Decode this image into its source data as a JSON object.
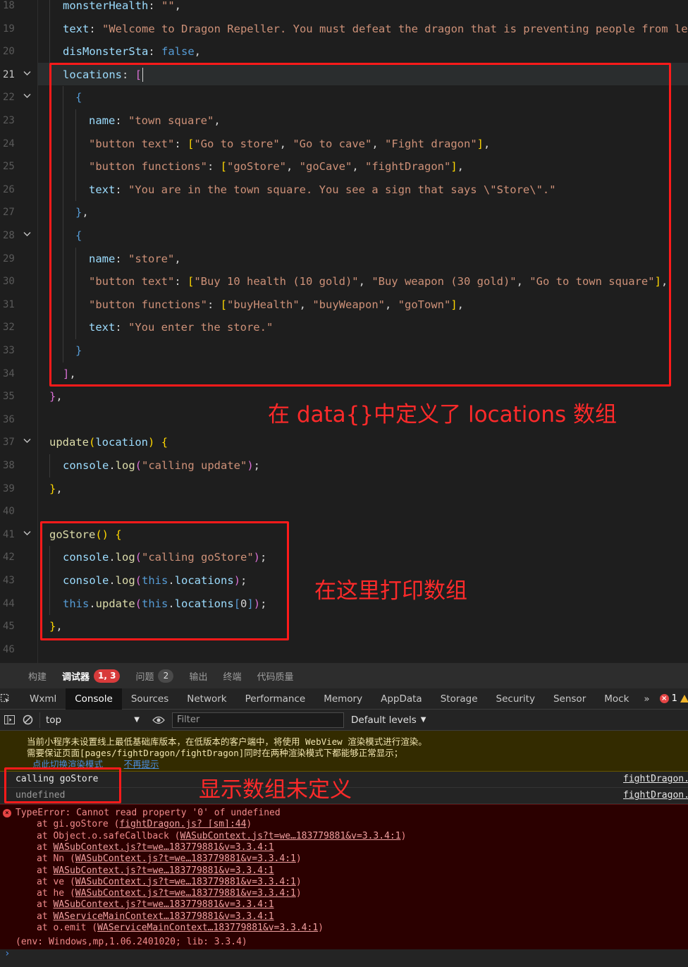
{
  "editor": {
    "lines": [
      {
        "n": "18",
        "indent": 1,
        "html": "<span class='k'>monsterHealth</span><span class='w'>: </span><span class='s'>\"\"</span><span class='w'>,</span>"
      },
      {
        "n": "19",
        "indent": 1,
        "html": "<span class='k'>text</span><span class='w'>: </span><span class='s'>\"Welcome to Dragon Repeller. You must defeat the dragon that is preventing people from leav</span>"
      },
      {
        "n": "20",
        "indent": 1,
        "html": "<span class='k'>disMonsterSta</span><span class='w'>: </span><span class='b'>false</span><span class='w'>,</span>"
      },
      {
        "n": "21",
        "indent": 1,
        "fold": true,
        "active": true,
        "html": "<span class='k'>locations</span><span class='w'>: </span><span class='p'>[</span>"
      },
      {
        "n": "22",
        "indent": 2,
        "fold": true,
        "html": "<span class='b'>{</span>"
      },
      {
        "n": "23",
        "indent": 3,
        "html": "<span class='k'>name</span><span class='w'>: </span><span class='s'>\"town square\"</span><span class='w'>,</span>"
      },
      {
        "n": "24",
        "indent": 3,
        "html": "<span class='s'>\"button text\"</span><span class='w'>: </span><span class='y'>[</span><span class='s'>\"Go to store\"</span><span class='w'>, </span><span class='s'>\"Go to cave\"</span><span class='w'>, </span><span class='s'>\"Fight dragon\"</span><span class='y'>]</span><span class='w'>,</span>"
      },
      {
        "n": "25",
        "indent": 3,
        "html": "<span class='s'>\"button functions\"</span><span class='w'>: </span><span class='y'>[</span><span class='s'>\"goStore\"</span><span class='w'>, </span><span class='s'>\"goCave\"</span><span class='w'>, </span><span class='s'>\"fightDragon\"</span><span class='y'>]</span><span class='w'>,</span>"
      },
      {
        "n": "26",
        "indent": 3,
        "html": "<span class='k'>text</span><span class='w'>: </span><span class='s'>\"You are in the town square. You see a sign that says \\\"Store\\\".\"</span>"
      },
      {
        "n": "27",
        "indent": 2,
        "html": "<span class='b'>}</span><span class='w'>,</span>"
      },
      {
        "n": "28",
        "indent": 2,
        "fold": true,
        "html": "<span class='b'>{</span>"
      },
      {
        "n": "29",
        "indent": 3,
        "html": "<span class='k'>name</span><span class='w'>: </span><span class='s'>\"store\"</span><span class='w'>,</span>"
      },
      {
        "n": "30",
        "indent": 3,
        "html": "<span class='s'>\"button text\"</span><span class='w'>: </span><span class='y'>[</span><span class='s'>\"Buy 10 health (10 gold)\"</span><span class='w'>, </span><span class='s'>\"Buy weapon (30 gold)\"</span><span class='w'>, </span><span class='s'>\"Go to town square\"</span><span class='y'>]</span><span class='w'>,</span>"
      },
      {
        "n": "31",
        "indent": 3,
        "html": "<span class='s'>\"button functions\"</span><span class='w'>: </span><span class='y'>[</span><span class='s'>\"buyHealth\"</span><span class='w'>, </span><span class='s'>\"buyWeapon\"</span><span class='w'>, </span><span class='s'>\"goTown\"</span><span class='y'>]</span><span class='w'>,</span>"
      },
      {
        "n": "32",
        "indent": 3,
        "html": "<span class='k'>text</span><span class='w'>: </span><span class='s'>\"You enter the store.\"</span>"
      },
      {
        "n": "33",
        "indent": 2,
        "html": "<span class='b'>}</span>"
      },
      {
        "n": "34",
        "indent": 1,
        "html": "<span class='p'>]</span><span class='w'>,</span>"
      },
      {
        "n": "35",
        "indent": 0,
        "html": "<span class='p'>}</span><span class='w'>,</span>"
      },
      {
        "n": "36",
        "indent": 0,
        "html": ""
      },
      {
        "n": "37",
        "indent": 0,
        "fold": true,
        "html": "<span class='f'>update</span><span class='y'>(</span><span class='k'>location</span><span class='y'>)</span><span class='w'> </span><span class='y'>{</span>"
      },
      {
        "n": "38",
        "indent": 1,
        "html": "<span class='k'>console</span><span class='w'>.</span><span class='f'>log</span><span class='p'>(</span><span class='s'>\"calling update\"</span><span class='p'>)</span><span class='w'>;</span>"
      },
      {
        "n": "39",
        "indent": 0,
        "html": "<span class='y'>}</span><span class='w'>,</span>"
      },
      {
        "n": "40",
        "indent": 0,
        "html": ""
      },
      {
        "n": "41",
        "indent": 0,
        "fold": true,
        "html": "<span class='f'>goStore</span><span class='y'>()</span><span class='w'> </span><span class='y'>{</span>"
      },
      {
        "n": "42",
        "indent": 1,
        "html": "<span class='k'>console</span><span class='w'>.</span><span class='f'>log</span><span class='p'>(</span><span class='s'>\"calling goStore\"</span><span class='p'>)</span><span class='w'>;</span>"
      },
      {
        "n": "43",
        "indent": 1,
        "html": "<span class='k'>console</span><span class='w'>.</span><span class='f'>log</span><span class='p'>(</span><span class='b'>this</span><span class='w'>.</span><span class='k'>locations</span><span class='p'>)</span><span class='w'>;</span>"
      },
      {
        "n": "44",
        "indent": 1,
        "html": "<span class='b'>this</span><span class='w'>.</span><span class='f'>update</span><span class='p'>(</span><span class='b'>this</span><span class='w'>.</span><span class='k'>locations</span><span class='b'>[</span><span class='w'>0</span><span class='b'>]</span><span class='p'>)</span><span class='w'>;</span>"
      },
      {
        "n": "45",
        "indent": 0,
        "html": "<span class='y'>}</span><span class='w'>,</span>"
      },
      {
        "n": "46",
        "indent": 0,
        "html": ""
      }
    ]
  },
  "annotations": {
    "locations_note": "在 data{}中定义了 locations 数组",
    "print_note": "在这里打印数组",
    "undefined_note": "显示数组未定义"
  },
  "panel_tabs": [
    {
      "label": "构建",
      "active": false
    },
    {
      "label": "调试器",
      "active": true,
      "badge": "1, 3",
      "badge_style": "red"
    },
    {
      "label": "问题",
      "active": false,
      "badge": "2",
      "badge_style": "gray"
    },
    {
      "label": "输出",
      "active": false
    },
    {
      "label": "终端",
      "active": false
    },
    {
      "label": "代码质量",
      "active": false
    }
  ],
  "devtools_tabs": [
    {
      "label": "Wxml",
      "active": false
    },
    {
      "label": "Console",
      "active": true
    },
    {
      "label": "Sources",
      "active": false
    },
    {
      "label": "Network",
      "active": false
    },
    {
      "label": "Performance",
      "active": false
    },
    {
      "label": "Memory",
      "active": false
    },
    {
      "label": "AppData",
      "active": false
    },
    {
      "label": "Storage",
      "active": false
    },
    {
      "label": "Security",
      "active": false
    },
    {
      "label": "Sensor",
      "active": false
    },
    {
      "label": "Mock",
      "active": false
    }
  ],
  "devtools_more": "»",
  "error_count": "1",
  "filterbar": {
    "context": "top",
    "filter_placeholder": "Filter",
    "levels": "Default levels"
  },
  "console": {
    "warning_lines": [
      "当前小程序未设置线上最低基础库版本，在低版本的客户端中，将使用 WebView 渲染模式进行渲染。",
      "需要保证页面[pages/fightDragon/fightDragon]同时在两种渲染模式下都能够正常显示；"
    ],
    "warning_links": [
      "点此切换渲染模式",
      "不再提示"
    ],
    "logs": [
      {
        "msg": "calling goStore",
        "src": "fightDragon.",
        "undef": false
      },
      {
        "msg": "undefined",
        "src": "fightDragon.",
        "undef": true
      }
    ],
    "error": {
      "title": "TypeError: Cannot read property '0' of undefined",
      "stack": [
        {
          "pre": "at gi.goStore (",
          "link": "fightDragon.js? [sm]:44",
          "post": ")"
        },
        {
          "pre": "at Object.o.safeCallback (",
          "link": "WASubContext.js?t=we…183779881&v=3.3.4:1",
          "post": ")"
        },
        {
          "pre": "at ",
          "link": "WASubContext.js?t=we…183779881&v=3.3.4:1",
          "post": ""
        },
        {
          "pre": "at Nn (",
          "link": "WASubContext.js?t=we…183779881&v=3.3.4:1",
          "post": ")"
        },
        {
          "pre": "at ",
          "link": "WASubContext.js?t=we…183779881&v=3.3.4:1",
          "post": ""
        },
        {
          "pre": "at ve (",
          "link": "WASubContext.js?t=we…183779881&v=3.3.4:1",
          "post": ")"
        },
        {
          "pre": "at he (",
          "link": "WASubContext.js?t=we…183779881&v=3.3.4:1",
          "post": ")"
        },
        {
          "pre": "at ",
          "link": "WASubContext.js?t=we…183779881&v=3.3.4:1",
          "post": ""
        },
        {
          "pre": "at ",
          "link": "WAServiceMainContext…183779881&v=3.3.4:1",
          "post": ""
        },
        {
          "pre": "at o.emit (",
          "link": "WAServiceMainContext…183779881&v=3.3.4:1",
          "post": ")"
        }
      ],
      "env": "(env: Windows,mp,1.06.2401020; lib: 3.3.4)"
    },
    "prompt": "›"
  },
  "icons": {
    "inspect": "inspect-element-icon",
    "clear": "clear-console-icon",
    "sidebar": "sidebar-toggle-icon",
    "eye": "live-expression-icon"
  }
}
